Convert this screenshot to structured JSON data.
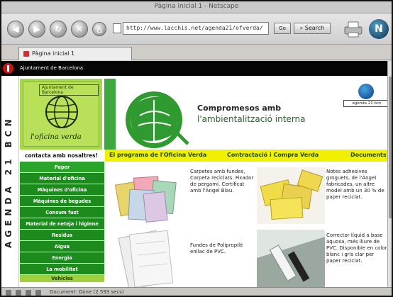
{
  "browser": {
    "window_title": "Pàgina inicial 1 - Netscape",
    "url": "http://www.lacchis.net/agenda21/ofverda/",
    "go_label": "Go",
    "search_label": "Search",
    "tab_label": "Pàgina inicial 1",
    "status_text": "Document: Done (2.593 secs)"
  },
  "site": {
    "org_name": "Ajuntament de Barcelona",
    "vertical_title": "AGENDA 21 BCN",
    "card_top_label": "Ajuntament de Barcelona",
    "card_name": "l'oficina verda",
    "contact_label": "contacta amb nosaltres!",
    "commit_line1": "Compromesos amb",
    "commit_line2": "l'ambientalització interna",
    "agenda_logo_label": "agenda 21 bcn"
  },
  "top_menu": [
    "El programa de l'Oficina Verda",
    "Contractació i Compra Verda",
    "Documents"
  ],
  "left_menu": [
    "Paper",
    "Material d'oficina",
    "Màquines d'oficina",
    "Màquines de begudes",
    "Consum fust",
    "Material de neteja i higiene",
    "Residus",
    "Aigua",
    "Energia",
    "La mobilitat",
    "Vehicles"
  ],
  "products": [
    {
      "desc": "Carpetes amb fundes, Carpeta reciclats. Fixador de pergamí. Certificat amb l'Àngel Blau."
    },
    {
      "desc": "Notes adhesives groguets, de l'Àngel fabricades, un altre model amb un 30 % de paper reciclat."
    },
    {
      "desc": "Fundes de Polipropilè enllac de PVC."
    },
    {
      "desc": "Corrector líquid a base aquosa, més lliure de PVC. Disponible en color blanc i gris clar per paper reciclat."
    }
  ],
  "colors": {
    "menu_green": "#1d8a1d",
    "menu_yellow": "#f0f000",
    "brand_red": "#d31010",
    "header_black": "#050505"
  }
}
